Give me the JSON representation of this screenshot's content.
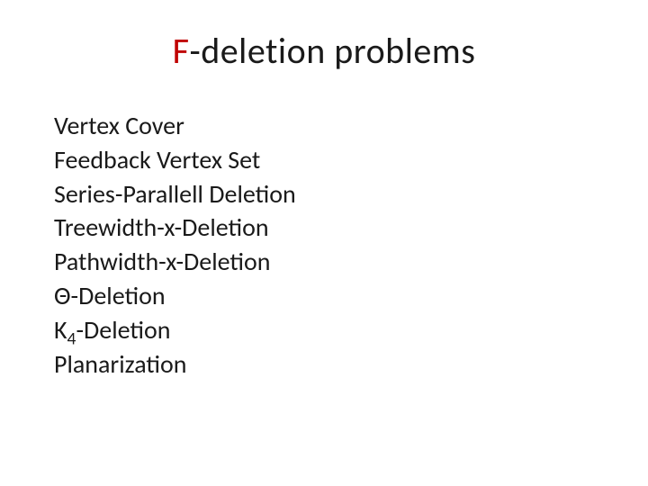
{
  "title": {
    "accent": "F",
    "rest": "-deletion problems"
  },
  "items": [
    "Vertex Cover",
    "Feedback Vertex Set",
    "Series-Parallell Deletion",
    "Treewidth-x-Deletion",
    "Pathwidth-x-Deletion",
    "Θ-Deletion",
    "K",
    "-Deletion",
    "Planarization"
  ],
  "k4_sub": "4"
}
